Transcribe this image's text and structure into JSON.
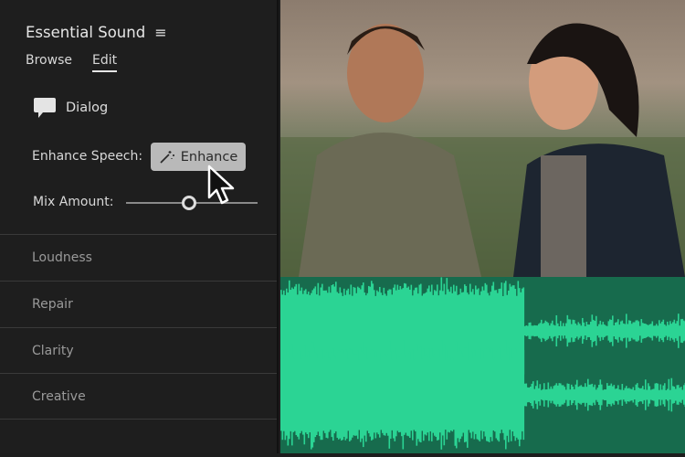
{
  "panel": {
    "title": "Essential Sound",
    "tabs": [
      "Browse",
      "Edit"
    ],
    "active_tab": "Edit",
    "clip_type": "Dialog",
    "enhance_label": "Enhance Speech:",
    "enhance_button": "Enhance",
    "mix_label": "Mix Amount:",
    "mix_amount": 0.48,
    "sections": [
      "Loudness",
      "Repair",
      "Clarity",
      "Creative"
    ]
  },
  "colors": {
    "panel_bg": "#1e1e1e",
    "wave_bg": "#176b4d",
    "wave_fill": "#2bd494",
    "button_bg": "#b9b9b9"
  },
  "waveform": {
    "enhanced_fraction": 0.6
  }
}
